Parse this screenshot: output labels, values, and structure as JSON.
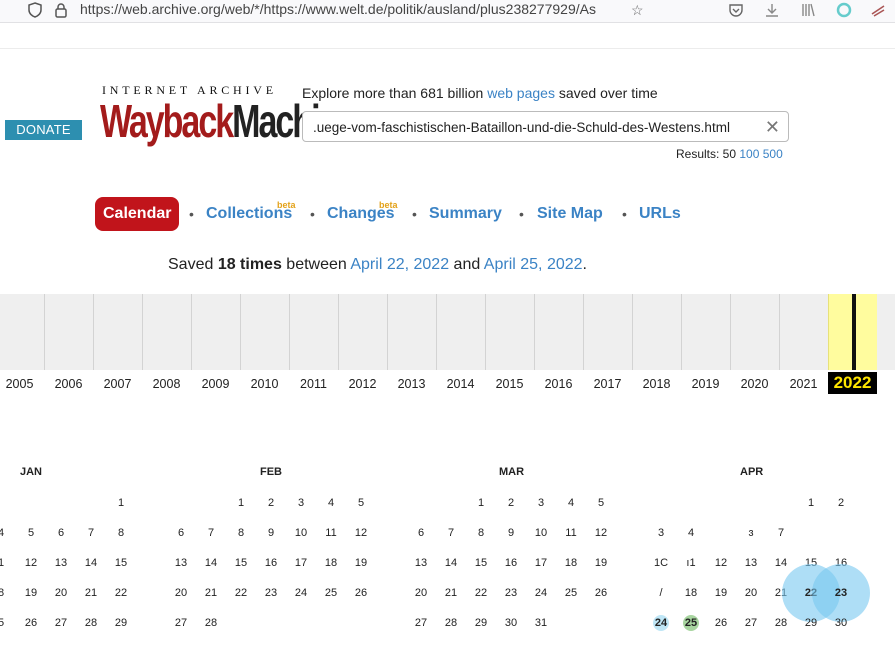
{
  "browser": {
    "url": "https://web.archive.org/web/*/https://www.welt.de/politik/ausland/plus238277929/As",
    "icons": [
      "shield-icon",
      "lock-icon",
      "star-icon",
      "pocket-icon",
      "download-icon",
      "library-icon",
      "extension-icon",
      "profile-icon"
    ]
  },
  "header": {
    "donate_label": "DONATE",
    "ia_text": "INTERNET ARCHIVE",
    "logo_part1": "Wayback",
    "logo_part2": "Machine",
    "explore_prefix": "Explore more than 681 billion ",
    "explore_link": "web pages",
    "explore_suffix": " saved over time",
    "search_value": ".uege-vom-faschistischen-Bataillon-und-die-Schuld-des-Westens.html",
    "clear_glyph": "✕",
    "results_label": "Results: 50 ",
    "results_100": "100",
    "results_500": "500"
  },
  "nav": {
    "tabs": [
      {
        "label": "Calendar",
        "active": true
      },
      {
        "label": "Collections",
        "beta": "beta"
      },
      {
        "label": "Changes",
        "beta": "beta"
      },
      {
        "label": "Summary"
      },
      {
        "label": "Site Map"
      },
      {
        "label": "URLs"
      }
    ],
    "separator": "•"
  },
  "saved": {
    "prefix": "Saved ",
    "count": "18 times",
    "between": " between ",
    "start": "April 22, 2022",
    "and": " and ",
    "end": "April 25, 2022",
    "period": "."
  },
  "timeline": {
    "years": [
      "2005",
      "2006",
      "2007",
      "2008",
      "2009",
      "2010",
      "2011",
      "2012",
      "2013",
      "2014",
      "2015",
      "2016",
      "2017",
      "2018",
      "2019",
      "2020",
      "2021",
      "2022"
    ],
    "current": "2022",
    "captures": {
      "2022": 1.0
    }
  },
  "calendar": {
    "months": [
      {
        "name": "JAN",
        "rows": [
          [
            "",
            "",
            "",
            "",
            "1"
          ],
          [
            "4",
            "5",
            "6",
            "7",
            "8"
          ],
          [
            "1",
            "12",
            "13",
            "14",
            "15"
          ],
          [
            "8",
            "19",
            "20",
            "21",
            "22"
          ],
          [
            "5",
            "26",
            "27",
            "28",
            "29"
          ]
        ]
      },
      {
        "name": "FEB",
        "rows": [
          [
            "",
            "",
            "1",
            "2",
            "3",
            "4",
            "5"
          ],
          [
            "6",
            "7",
            "8",
            "9",
            "10",
            "11",
            "12"
          ],
          [
            "13",
            "14",
            "15",
            "16",
            "17",
            "18",
            "19"
          ],
          [
            "20",
            "21",
            "22",
            "23",
            "24",
            "25",
            "26"
          ],
          [
            "27",
            "28",
            "",
            "",
            "",
            "",
            ""
          ]
        ]
      },
      {
        "name": "MAR",
        "rows": [
          [
            "",
            "",
            "1",
            "2",
            "3",
            "4",
            "5"
          ],
          [
            "6",
            "7",
            "8",
            "9",
            "10",
            "11",
            "12"
          ],
          [
            "13",
            "14",
            "15",
            "16",
            "17",
            "18",
            "19"
          ],
          [
            "20",
            "21",
            "22",
            "23",
            "24",
            "25",
            "26"
          ],
          [
            "27",
            "28",
            "29",
            "30",
            "31",
            "",
            ""
          ]
        ]
      },
      {
        "name": "APR",
        "rows": [
          [
            "",
            "",
            "",
            "",
            "",
            "1",
            "2"
          ],
          [
            "3",
            "4",
            "",
            "ɜ",
            "7",
            "",
            ""
          ],
          [
            "1C",
            "ı1",
            "12",
            "13",
            "14",
            "15",
            "16"
          ],
          [
            "/",
            "18",
            "19",
            "20",
            "21",
            "22",
            "23"
          ],
          [
            "24",
            "25",
            "26",
            "27",
            "28",
            "29",
            "30"
          ]
        ]
      }
    ],
    "highlighted": {
      "22": "blue",
      "23": "blue",
      "24": "lightblue",
      "25": "green"
    }
  }
}
